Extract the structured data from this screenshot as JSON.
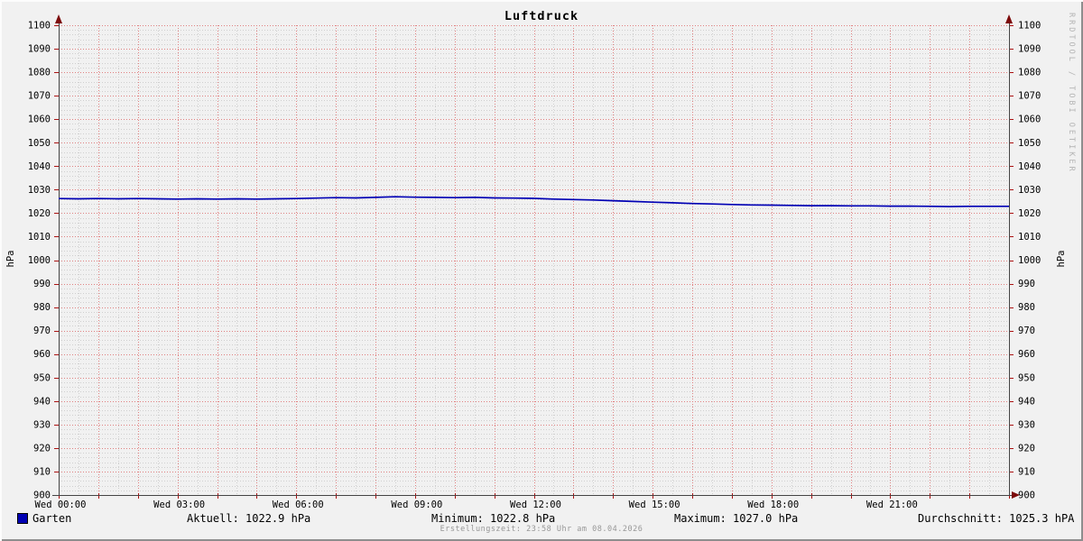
{
  "title": "Luftdruck",
  "watermark": "RRDTOOL / TOBI OETIKER",
  "footer": {
    "creation_time": "Erstellungszeit: 23:58 Uhr am 08.04.2026"
  },
  "legend": {
    "label": "Garten",
    "swatch_color": "#0000b4"
  },
  "stats": {
    "aktuell": "Aktuell: 1022.9 hPa",
    "minimum": "Minimum: 1022.8 hPa",
    "maximum": "Maximum: 1027.0 hPa",
    "durchschnitt": "Durchschnitt: 1025.3 hPA"
  },
  "chart_data": {
    "type": "line",
    "title": "Luftdruck",
    "ylabel": "hPa",
    "ylabel_right": "hPa",
    "ylim": [
      900,
      1100
    ],
    "y_major_step": 10,
    "y_minor_step": 2,
    "xlim_hours": [
      0,
      24
    ],
    "x_major_step_hours": 1,
    "x_minor_step_hours": 0.5,
    "grid": true,
    "legend_position": "bottom-left",
    "y_ticks": [
      900,
      910,
      920,
      930,
      940,
      950,
      960,
      970,
      980,
      990,
      1000,
      1010,
      1020,
      1030,
      1040,
      1050,
      1060,
      1070,
      1080,
      1090,
      1100
    ],
    "x_ticks": [
      {
        "hour": 0,
        "label": "Wed 00:00"
      },
      {
        "hour": 3,
        "label": "Wed 03:00"
      },
      {
        "hour": 6,
        "label": "Wed 06:00"
      },
      {
        "hour": 9,
        "label": "Wed 09:00"
      },
      {
        "hour": 12,
        "label": "Wed 12:00"
      },
      {
        "hour": 15,
        "label": "Wed 15:00"
      },
      {
        "hour": 18,
        "label": "Wed 18:00"
      },
      {
        "hour": 21,
        "label": "Wed 21:00"
      }
    ],
    "colors": {
      "background": "#f1f1f1",
      "minor_grid": "#cfcfcf",
      "major_grid": "#e08080",
      "tick": "#aa1111",
      "axis": "#444444",
      "arrow": "#7c0b0b",
      "line": "#0000b4"
    },
    "series": [
      {
        "name": "Garten",
        "color": "#0000b4",
        "x": [
          0,
          0.5,
          1,
          1.5,
          2,
          2.5,
          3,
          3.5,
          4,
          4.5,
          5,
          5.5,
          6,
          6.5,
          7,
          7.5,
          8,
          8.5,
          9,
          9.5,
          10,
          10.5,
          11,
          11.5,
          12,
          12.5,
          13,
          13.5,
          14,
          14.5,
          15,
          15.5,
          16,
          16.5,
          17,
          17.5,
          18,
          18.5,
          19,
          19.5,
          20,
          20.5,
          21,
          21.5,
          22,
          22.5,
          23,
          23.5,
          24
        ],
        "values": [
          1026.2,
          1026.1,
          1026.2,
          1026.1,
          1026.2,
          1026.1,
          1026.0,
          1026.1,
          1026.0,
          1026.1,
          1026.0,
          1026.1,
          1026.2,
          1026.4,
          1026.6,
          1026.5,
          1026.7,
          1027.0,
          1026.8,
          1026.7,
          1026.6,
          1026.7,
          1026.5,
          1026.4,
          1026.3,
          1026.0,
          1025.8,
          1025.6,
          1025.3,
          1025.0,
          1024.7,
          1024.4,
          1024.1,
          1023.9,
          1023.7,
          1023.5,
          1023.4,
          1023.3,
          1023.2,
          1023.2,
          1023.1,
          1023.1,
          1023.0,
          1023.0,
          1022.9,
          1022.8,
          1022.9,
          1022.9,
          1022.9
        ]
      }
    ],
    "stats": {
      "current": 1022.9,
      "min": 1022.8,
      "max": 1027.0,
      "avg": 1025.3,
      "unit": "hPa"
    }
  }
}
